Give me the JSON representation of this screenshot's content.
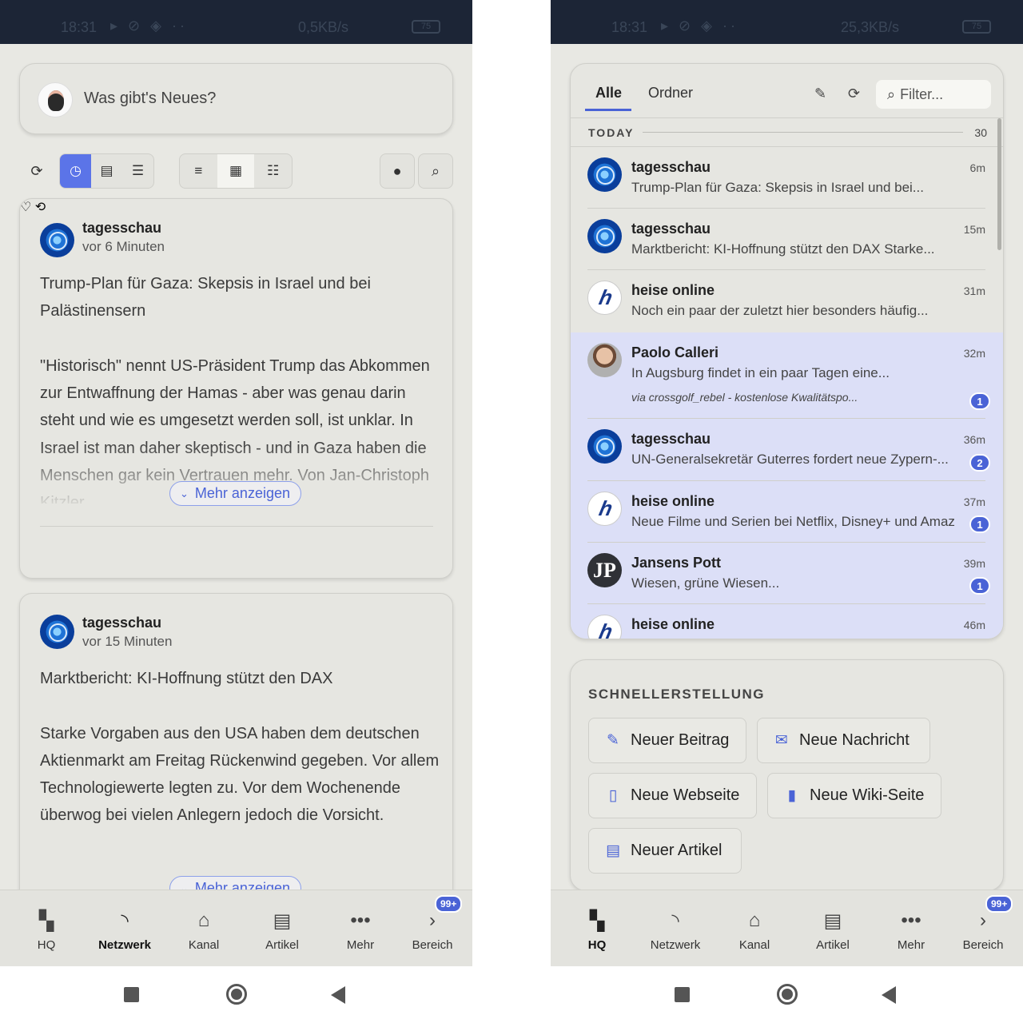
{
  "status": {
    "left": {
      "time": "18:31",
      "rate": "0,5KB/s",
      "battery": "75"
    },
    "right": {
      "time": "18:31",
      "rate": "25,3KB/s",
      "battery": "75"
    }
  },
  "compose": {
    "placeholder": "Was gibt's Neues?"
  },
  "feed": [
    {
      "author": "tagesschau",
      "time": "vor 6 Minuten",
      "text": "Trump-Plan für Gaza: Skepsis in Israel und bei Palästinensern\n\n\"Historisch\" nennt US-Präsident Trump das Abkommen zur Entwaffnung der Hamas - aber was genau darin steht und wie es umgesetzt werden soll, ist unklar. In Israel ist man daher skeptisch - und in Gaza haben die Menschen gar kein Vertrauen mehr. Von Jan-Christoph Kitzler.",
      "more": "Mehr anzeigen"
    },
    {
      "author": "tagesschau",
      "time": "vor 15 Minuten",
      "text": "Marktbericht: KI-Hoffnung stützt den DAX\n\nStarke Vorgaben aus den USA haben dem deutschen Aktienmarkt am Freitag Rückenwind gegeben. Vor allem Technologiewerte legten zu. Vor dem Wochenende überwog bei vielen Anlegern jedoch die Vorsicht.",
      "more": "Mehr anzeigen"
    }
  ],
  "nav": {
    "items": [
      {
        "label": "HQ",
        "icon": "dashboard-icon"
      },
      {
        "label": "Netzwerk",
        "icon": "rss-icon"
      },
      {
        "label": "Kanal",
        "icon": "home-icon"
      },
      {
        "label": "Artikel",
        "icon": "article-icon"
      },
      {
        "label": "Mehr",
        "icon": "more-icon"
      },
      {
        "label": "Bereich",
        "icon": "chevron-right-icon"
      }
    ],
    "badge": "99+",
    "left_active": "Netzwerk",
    "right_active": "HQ"
  },
  "inbox": {
    "tabs": [
      "Alle",
      "Ordner"
    ],
    "filter_placeholder": "Filter...",
    "section_label": "TODAY",
    "section_count": "30",
    "items": [
      {
        "name": "tagesschau",
        "snippet": "Trump-Plan für Gaza: Skepsis in Israel und bei...",
        "time": "6m",
        "badge": ""
      },
      {
        "name": "tagesschau",
        "snippet": "Marktbericht: KI-Hoffnung stützt den DAX Starke...",
        "time": "15m",
        "badge": ""
      },
      {
        "name": "heise online",
        "snippet": "Noch ein paar der zuletzt hier besonders häufig...",
        "time": "31m",
        "badge": ""
      },
      {
        "name": "Paolo Calleri",
        "snippet": "In Augsburg findet in ein paar Tagen eine...",
        "via": "via crossgolf_rebel - kostenlose Kwalitätspo...",
        "time": "32m",
        "badge": "1"
      },
      {
        "name": "tagesschau",
        "snippet": "UN-Generalsekretär Guterres fordert neue Zypern-...",
        "time": "36m",
        "badge": "2"
      },
      {
        "name": "heise online",
        "snippet": "Neue Filme und Serien bei Netflix, Disney+ und Amaz",
        "time": "37m",
        "badge": "1"
      },
      {
        "name": "Jansens Pott",
        "snippet": "Wiesen, grüne Wiesen...",
        "time": "39m",
        "badge": "1"
      },
      {
        "name": "heise online",
        "snippet": "",
        "time": "46m",
        "badge": ""
      }
    ]
  },
  "quick": {
    "title": "SCHNELLERSTELLUNG",
    "buttons": [
      "Neuer Beitrag",
      "Neue Nachricht",
      "Neue Webseite",
      "Neue Wiki-Seite",
      "Neuer Artikel"
    ]
  },
  "colors": {
    "accent": "#4a63d6",
    "unread_bg": "#dcdff7",
    "statusbar": "#1c2536",
    "surface": "#e6e6e1"
  }
}
